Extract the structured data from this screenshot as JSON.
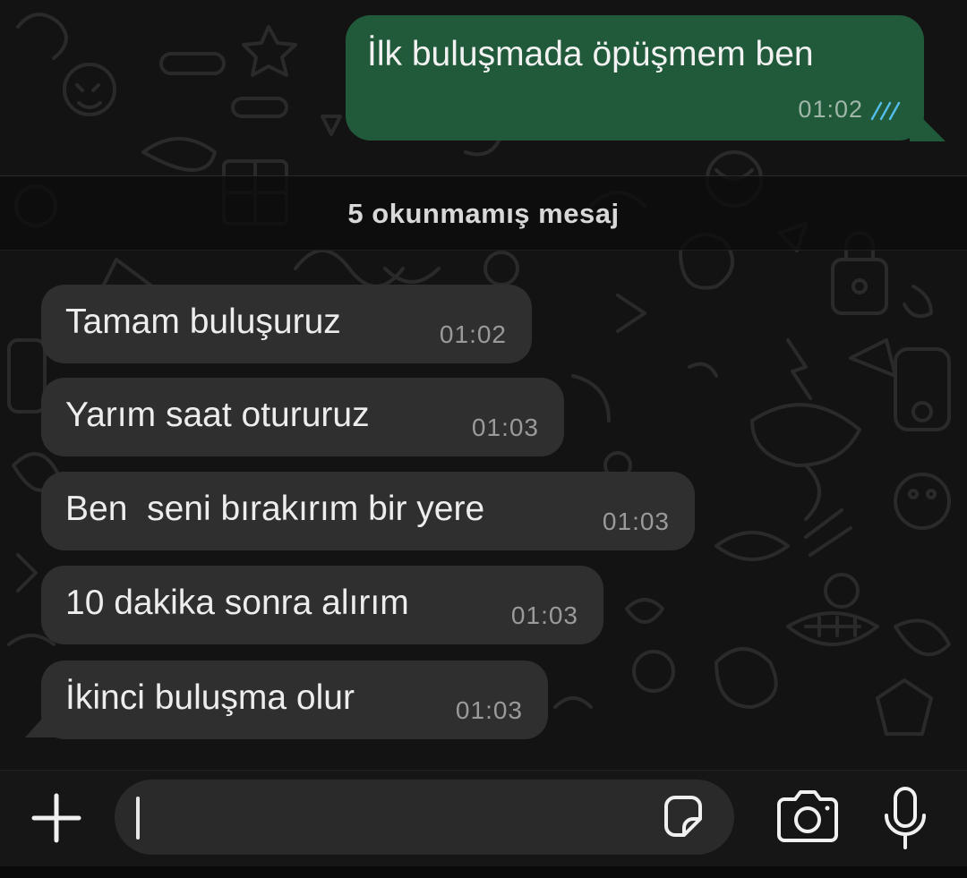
{
  "chat": {
    "outgoing": {
      "text": "İlk buluşmada öpüşmem ben",
      "time": "01:02",
      "status_icon": "double-check-read-icon"
    },
    "unread_divider": "5 okunmamış mesaj",
    "incoming": [
      {
        "text": "Tamam buluşuruz",
        "time": "01:02"
      },
      {
        "text": "Yarım saat otururuz",
        "time": "01:03"
      },
      {
        "text": "Ben  seni bırakırım bir yere",
        "time": "01:03"
      },
      {
        "text": "10 dakika sonra alırım",
        "time": "01:03"
      },
      {
        "text": "İkinci buluşma olur",
        "time": "01:03"
      }
    ]
  },
  "input_bar": {
    "message_value": "",
    "icons": [
      "plus-icon",
      "sticker-icon",
      "camera-icon",
      "microphone-icon"
    ]
  },
  "colors": {
    "outgoing_bubble": "#215a3b",
    "incoming_bubble": "#2f2f2f",
    "read_check": "#53bdeb",
    "background": "#111111"
  }
}
